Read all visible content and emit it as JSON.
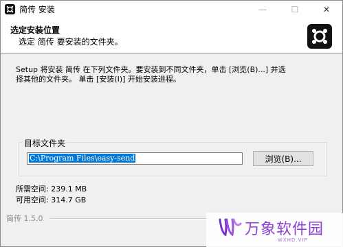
{
  "window": {
    "title": "简传 安装",
    "minimize_glyph": "—",
    "maximize_glyph": "☐",
    "close_glyph": "✕"
  },
  "header": {
    "title": "选定安装位置",
    "subtitle": "选定 简传 要安装的文件夹。"
  },
  "description": "Setup 将安装 简传 在下列文件夹。要安装到不同文件夹，单击 [浏览(B)...] 并选\n择其他的文件夹。 单击 [安装(I)] 开始安装进程。",
  "destination": {
    "group_label": "目标文件夹",
    "path": "C:\\Program Files\\easy-send",
    "browse_label": "浏览(B)..."
  },
  "space": {
    "required": "所需空间: 239.1 MB",
    "available": "可用空间: 314.7 GB"
  },
  "footer": {
    "brand": "简传 1.5.0"
  },
  "watermark": {
    "text": "万象软件园",
    "sub": "WXHD.VIP"
  },
  "colors": {
    "accent": "#0078d7",
    "watermark": "#8e3fd6"
  }
}
